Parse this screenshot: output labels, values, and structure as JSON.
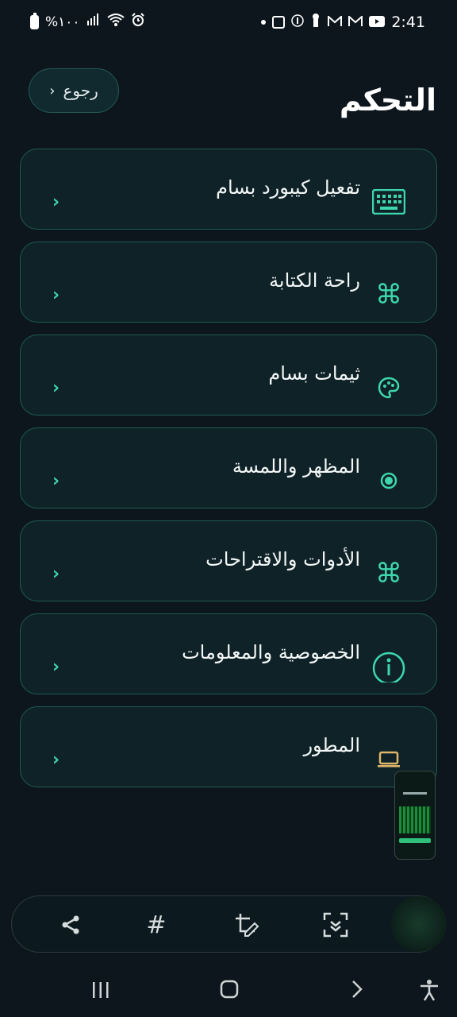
{
  "status_bar": {
    "battery_text": "%١٠٠",
    "time": "2:41"
  },
  "header": {
    "back_label": "رجوع",
    "title": "التحكم"
  },
  "menu": [
    {
      "label": "تفعيل كيبورد بسام",
      "icon": "keyboard-icon"
    },
    {
      "label": "راحة الكتابة",
      "icon": "command-icon"
    },
    {
      "label": "ثيمات بسام",
      "icon": "palette-icon"
    },
    {
      "label": "المظهر واللمسة",
      "icon": "radio-dot-icon"
    },
    {
      "label": "الأدوات والاقتراحات",
      "icon": "command-icon"
    },
    {
      "label": "الخصوصية والمعلومات",
      "icon": "info-icon"
    },
    {
      "label": "المطور",
      "icon": "laptop-icon"
    }
  ],
  "toolbar": {
    "items": [
      "share-icon",
      "hashtag-icon",
      "crop-edit-icon",
      "scan-icon",
      "preview-thumbnail"
    ]
  },
  "colors": {
    "background": "#0c161c",
    "card": "#0f2228",
    "card_border": "#1f5a52",
    "accent": "#3ed6ac",
    "laptop_icon": "#e0b66a"
  }
}
